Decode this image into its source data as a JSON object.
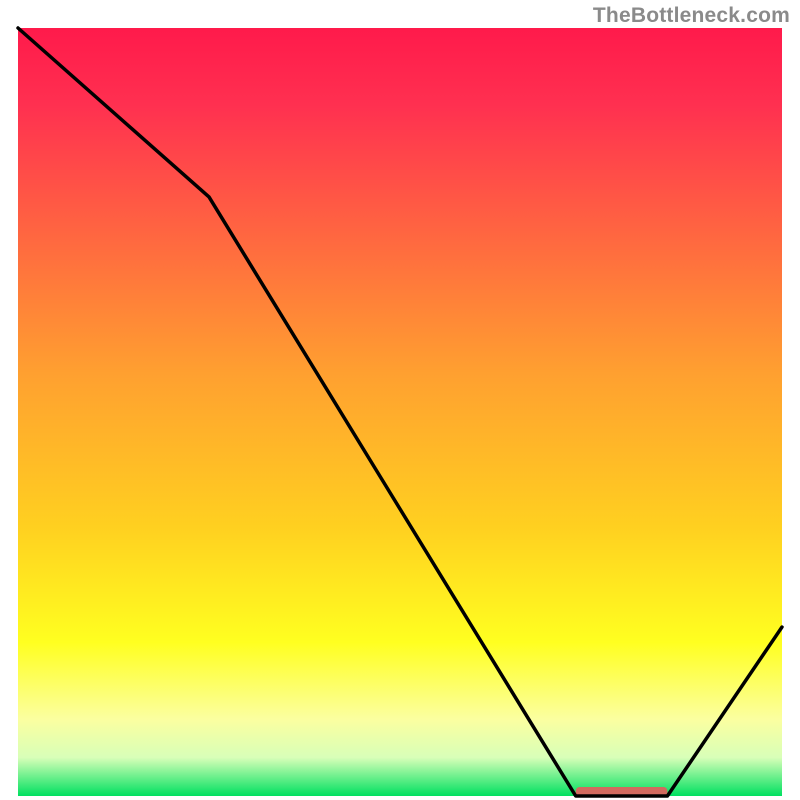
{
  "watermark": "TheBottleneck.com",
  "chart_data": {
    "type": "line",
    "title": "",
    "xlabel": "",
    "ylabel": "",
    "xlim": [
      0,
      100
    ],
    "ylim": [
      0,
      100
    ],
    "grid": false,
    "legend": false,
    "series": [
      {
        "name": "bottleneck-curve",
        "x": [
          0,
          25,
          73,
          85,
          100
        ],
        "y": [
          100,
          78,
          0,
          0,
          22
        ]
      }
    ],
    "highlight_region": {
      "x_start": 73,
      "x_end": 85,
      "y": 0
    },
    "gradient_stops": [
      {
        "offset": 0.0,
        "color": "#ff1a4b"
      },
      {
        "offset": 0.1,
        "color": "#ff3050"
      },
      {
        "offset": 0.45,
        "color": "#ffa030"
      },
      {
        "offset": 0.65,
        "color": "#ffd020"
      },
      {
        "offset": 0.8,
        "color": "#ffff20"
      },
      {
        "offset": 0.9,
        "color": "#fbffa0"
      },
      {
        "offset": 0.95,
        "color": "#d8ffb8"
      },
      {
        "offset": 1.0,
        "color": "#00e060"
      }
    ],
    "colors": {
      "curve": "#000000",
      "border": "#ffffff",
      "highlight": "#d16a5f"
    }
  }
}
